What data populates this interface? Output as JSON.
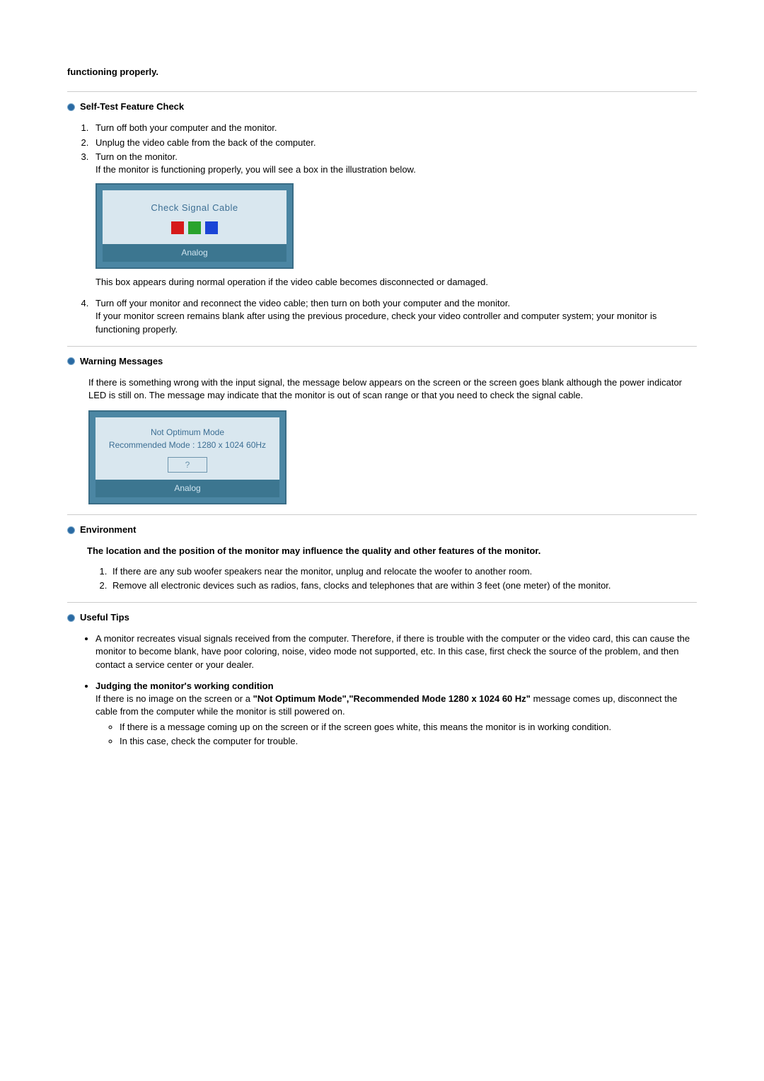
{
  "intro": "functioning properly.",
  "sections": {
    "selftest": {
      "heading": "Self-Test Feature Check",
      "steps": [
        {
          "text": "Turn off both your computer and the monitor."
        },
        {
          "text": "Unplug the video cable from the back of the computer."
        },
        {
          "text": "Turn on the monitor.",
          "extra": "If the monitor is functioning properly, you will see a box in the illustration below."
        },
        {
          "text": "Turn off your monitor and reconnect the video cable; then turn on both your computer and the monitor.",
          "extra": "If your monitor screen remains blank after using the previous procedure, check your video controller and computer system; your monitor is functioning properly."
        }
      ],
      "illustration": {
        "title": "Check Signal Cable",
        "footer": "Analog"
      },
      "afterImage": "This box appears during normal operation if the video cable becomes disconnected or damaged."
    },
    "warnings": {
      "heading": "Warning Messages",
      "body": "If there is something wrong with the input signal, the message below appears on the screen or the screen goes blank although the power indicator LED is still on. The message may indicate that the monitor is out of scan range or that you need to check the signal cable.",
      "illustration": {
        "line1": "Not Optimum Mode",
        "line2": "Recommended Mode : 1280 x 1024  60Hz",
        "question": "?",
        "footer": "Analog"
      }
    },
    "environment": {
      "heading": "Environment",
      "bold": "The location and the position of the monitor may influence the quality and other features of the monitor.",
      "items": [
        "If there are any sub woofer speakers near the monitor, unplug and relocate the woofer to another room.",
        "Remove all electronic devices such as radios, fans, clocks and telephones that are within 3 feet (one meter) of the monitor."
      ]
    },
    "tips": {
      "heading": "Useful Tips",
      "item1": "A monitor recreates visual signals received from the computer. Therefore, if there is trouble with the computer or the video card, this can cause the monitor to become blank, have poor coloring, noise, video mode not supported, etc. In this case, first check the source of the problem, and then contact a service center or your dealer.",
      "item2": {
        "title": "Judging the monitor's working condition",
        "pre": "If there is no image on the screen or a ",
        "bold": "\"Not Optimum Mode\",\"Recommended Mode 1280 x 1024 60 Hz\"",
        "post": " message comes up, disconnect the cable from the computer while the monitor is still powered on.",
        "subs": [
          "If there is a message coming up on the screen or if the screen goes white, this means the monitor is in working condition.",
          "In this case, check the computer for trouble."
        ]
      }
    }
  }
}
